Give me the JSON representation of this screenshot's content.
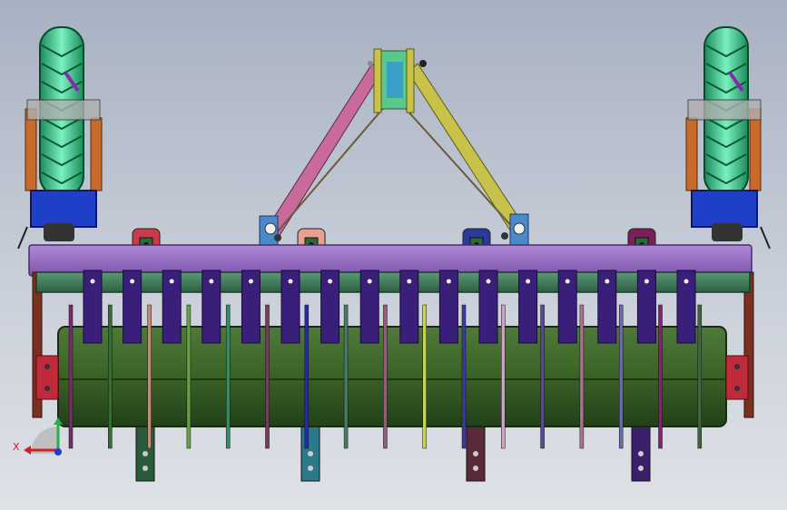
{
  "view": {
    "background_top": "#a8b1c2",
    "background_bottom": "#dfe2e7"
  },
  "triad": {
    "x_label": "X",
    "x_color": "#d0202a",
    "y_color": "#22b04a",
    "z_color": "#2838c8"
  },
  "colors": {
    "tire": "#3fd690",
    "tire_dark": "#1c8a5a",
    "wheel_frame": "#1f3fc8",
    "top_link_left": "#c86b9a",
    "top_link_right": "#c8c24a",
    "main_beam": "#9a6cc8",
    "tine_bar": "#3a7a5a",
    "tine": "#3a1f7a",
    "roller": "#3d6a2a",
    "roller_dark": "#24451a",
    "frame_side": "#7a3020",
    "hub": "#c02a3a"
  },
  "parts": {
    "mast_brackets": [
      "#cc3a4a",
      "#e8a090",
      "#2a3a9a",
      "#7a1f5a"
    ],
    "lower_shanks": [
      "#2a5a3a",
      "#2a7a8a",
      "#5a2a3a",
      "#3a1f6a"
    ],
    "roller_spikes": [
      "#7a2a6a",
      "#3a6a3a",
      "#c88a6a",
      "#6aa04a",
      "#3a8a6a",
      "#7a3a5a",
      "#2a2aa0",
      "#4a7a6a",
      "#9a5a7a",
      "#c8d060",
      "#3a3aa0",
      "#d0a0c8",
      "#5a4a8a",
      "#b07090",
      "#6a6ab0"
    ]
  }
}
